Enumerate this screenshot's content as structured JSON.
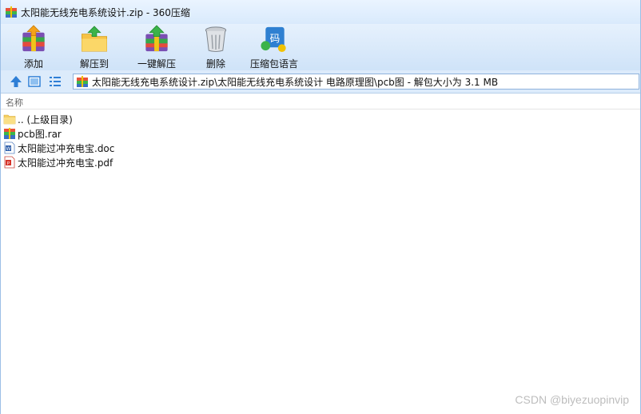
{
  "window": {
    "title": "太阳能无线充电系统设计.zip - 360压缩"
  },
  "toolbar": {
    "buttons": [
      {
        "label": "添加",
        "icon": "add-archive-icon"
      },
      {
        "label": "解压到",
        "icon": "extract-to-icon"
      },
      {
        "label": "一键解压",
        "icon": "one-click-extract-icon"
      },
      {
        "label": "删除",
        "icon": "delete-trash-icon"
      },
      {
        "label": "压缩包语言",
        "icon": "archive-language-icon"
      }
    ]
  },
  "address": {
    "path": "太阳能无线充电系统设计.zip\\太阳能无线充电系统设计 电路原理图\\pcb图 - 解包大小为 3.1 MB"
  },
  "file_list": {
    "column_name": "名称",
    "items": [
      {
        "name": ".. (上级目录)",
        "icon": "parent-folder-icon"
      },
      {
        "name": "pcb图.rar",
        "icon": "rar-archive-icon"
      },
      {
        "name": "太阳能过冲充电宝.doc",
        "icon": "word-document-icon"
      },
      {
        "name": "太阳能过冲充电宝.pdf",
        "icon": "pdf-document-icon"
      }
    ]
  },
  "watermark": "CSDN @biyezuopinvip"
}
